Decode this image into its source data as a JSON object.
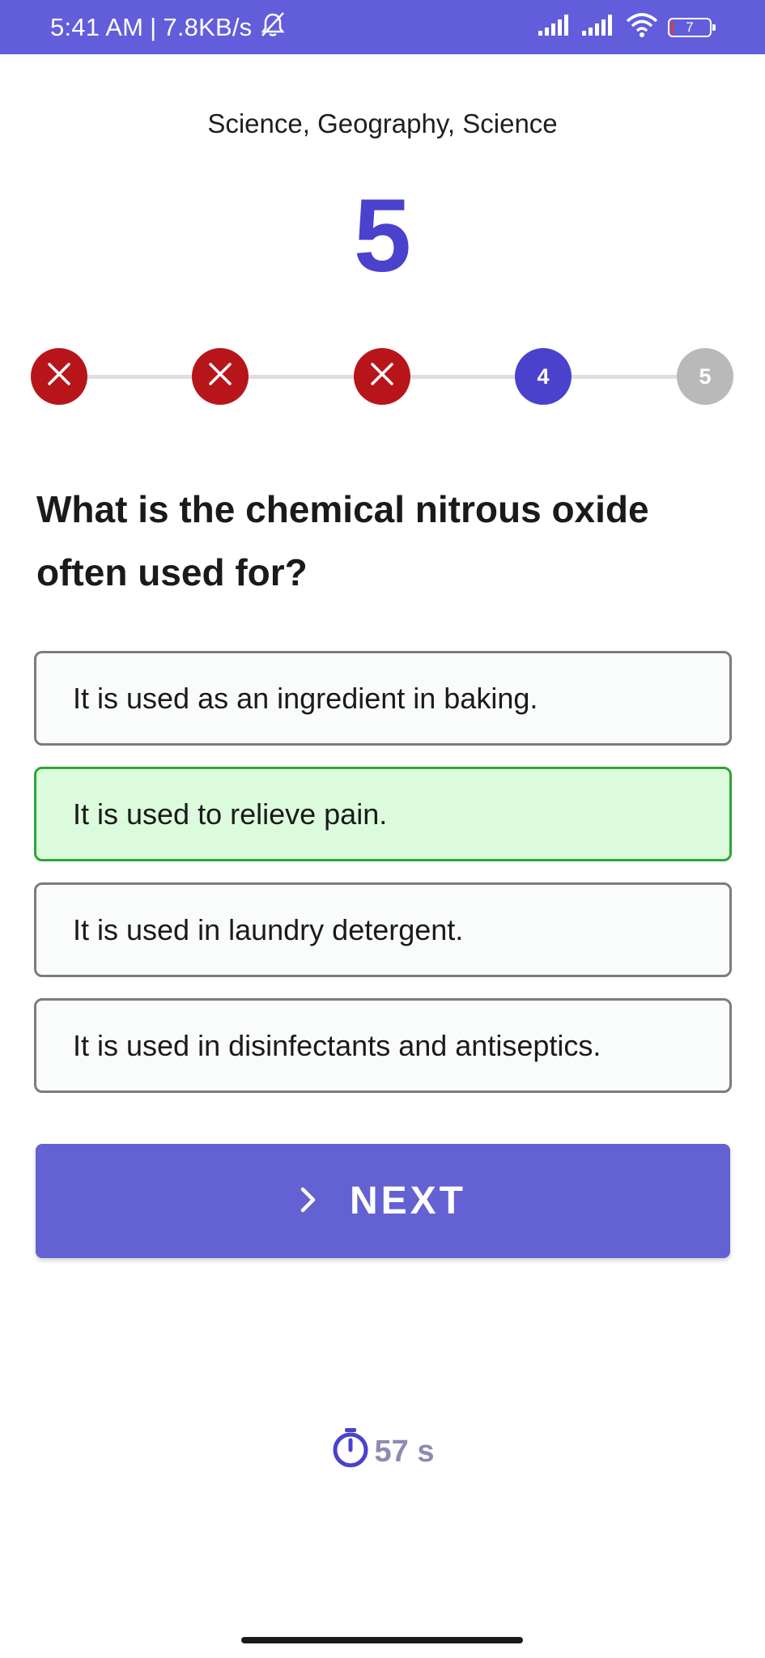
{
  "status_bar": {
    "time": "5:41 AM",
    "separator": "|",
    "speed": "7.8KB/s",
    "battery_level": "7",
    "icons": [
      "mute-notifications-icon",
      "signal-icon",
      "signal-icon",
      "wifi-icon",
      "battery-icon"
    ]
  },
  "quiz": {
    "categories": "Science, Geography, Science",
    "current_number": "5",
    "progress": {
      "steps": [
        {
          "state": "wrong",
          "label": ""
        },
        {
          "state": "wrong",
          "label": ""
        },
        {
          "state": "wrong",
          "label": ""
        },
        {
          "state": "current",
          "label": "4"
        },
        {
          "state": "upcoming",
          "label": "5"
        }
      ]
    },
    "question": "What is the chemical nitrous oxide often used for?",
    "options": [
      {
        "text": "It is used as an ingredient in baking.",
        "state": "default"
      },
      {
        "text": "It is used to relieve pain.",
        "state": "correct"
      },
      {
        "text": "It is used in laundry detergent.",
        "state": "default"
      },
      {
        "text": "It is used in disinfectants and antiseptics.",
        "state": "default"
      }
    ],
    "next_label": "NEXT",
    "timer": "57 s"
  },
  "colors": {
    "brand": "#625ddb",
    "accent": "#4a41cc",
    "wrong": "#b8151b",
    "correct_bg": "#dcfbdc",
    "correct_border": "#2ea43a"
  }
}
